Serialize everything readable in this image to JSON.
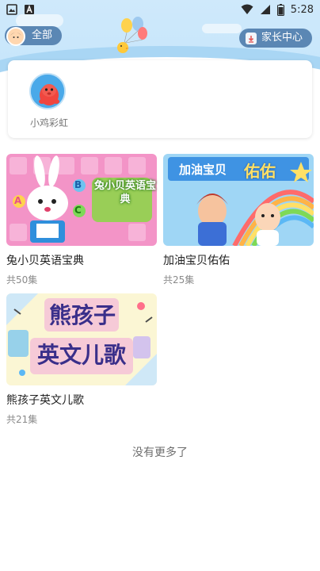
{
  "status_bar": {
    "time": "5:28",
    "icons": [
      "gallery-icon",
      "a-letter-icon",
      "wifi-icon",
      "signal-icon",
      "battery-icon"
    ]
  },
  "header": {
    "all_label": "全部",
    "parent_center_label": "家长中心"
  },
  "profile": {
    "name": "小鸡彩虹"
  },
  "series": [
    {
      "title": "兔小贝英语宝典",
      "count": "共50集",
      "thumb_text": "兔小贝英语宝典",
      "thumb_letters": [
        "A",
        "B",
        "C"
      ]
    },
    {
      "title": "加油宝贝佑佑",
      "count": "共25集",
      "thumb_text_line1": "加油宝贝",
      "thumb_text_line2": "佑佑"
    },
    {
      "title": "熊孩子英文儿歌",
      "count": "共21集",
      "thumb_text_line1": "熊孩子",
      "thumb_text_line2": "英文儿歌"
    }
  ],
  "footer": {
    "end_text": "没有更多了"
  },
  "colors": {
    "pill_bg": "#5b87b4",
    "header_bg": "#c7e6fb",
    "card_bg": "#ffffff"
  }
}
